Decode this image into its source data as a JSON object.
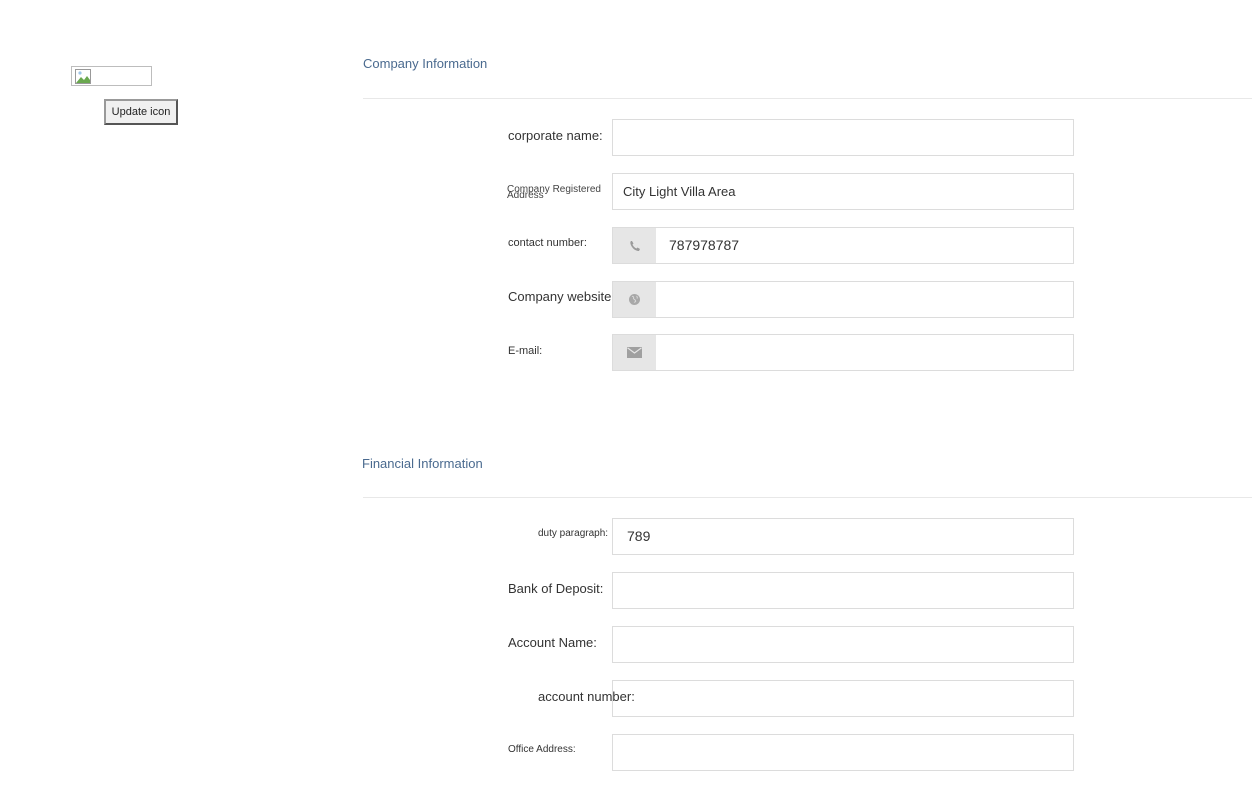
{
  "sidebar": {
    "update_icon_label": "Update icon"
  },
  "company": {
    "title": "Company Information",
    "corporate_name_label": "corporate name:",
    "corporate_name_value": "",
    "address_label_line1": "Company Registered",
    "address_label_line2": "Address",
    "address_value": "City Light Villa Area",
    "contact_label": "contact number:",
    "contact_value": "787978787",
    "website_label": "Company website:",
    "website_value": "",
    "email_label": "E-mail:",
    "email_value": ""
  },
  "financial": {
    "title": "Financial Information",
    "duty_label": "duty paragraph:",
    "duty_value": "789",
    "bank_label": "Bank of Deposit:",
    "bank_value": "",
    "account_name_label": "Account Name:",
    "account_name_value": "",
    "account_number_label": "account number:",
    "account_number_value": "",
    "office_label": "Office Address:",
    "office_value": ""
  },
  "icons": {
    "phone": "phone-icon",
    "globe": "globe-icon",
    "envelope": "envelope-icon"
  },
  "colors": {
    "section_title": "#4a6a8f",
    "addon_bg": "#e6e6e6",
    "field_border": "#dcdcdc"
  }
}
